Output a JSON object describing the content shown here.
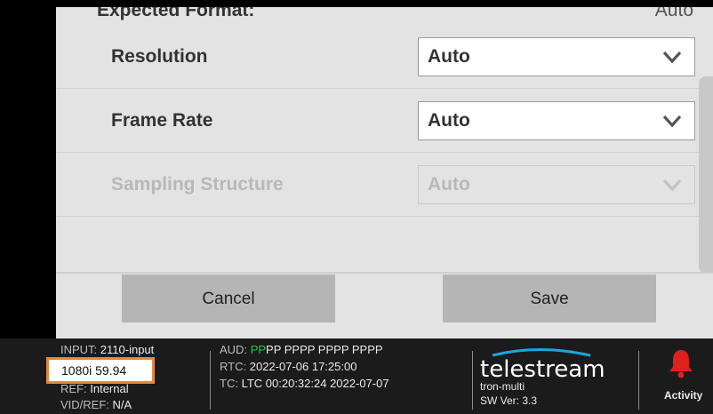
{
  "settings": {
    "expected_format": {
      "label": "Expected Format:",
      "value": "Auto"
    },
    "fields": [
      {
        "label": "Resolution",
        "value": "Auto",
        "enabled": true
      },
      {
        "label": "Frame Rate",
        "value": "Auto",
        "enabled": true
      },
      {
        "label": "Sampling Structure",
        "value": "Auto",
        "enabled": false
      }
    ]
  },
  "actions": {
    "cancel": "Cancel",
    "save": "Save"
  },
  "status": {
    "input_key": "INPUT:",
    "input_val": "2110-input",
    "format": "1080i 59.94",
    "ref_key": "REF:",
    "ref_val": "Internal",
    "vidref_key": "VID/REF:",
    "vidref_val": "N/A",
    "aud_key": "AUD:",
    "aud_green": "PP",
    "aud_rest": "PP PPPP PPPP PPPP",
    "rtc_key": "RTC:",
    "rtc_val": "2022-07-06 17:25:00",
    "tc_key": "TC:",
    "tc_val": "LTC 00:20:32:24 2022-07-07",
    "brand": "telestream",
    "device": "tron-multi",
    "sw_version": "SW Ver: 3.3",
    "activity": "Activity"
  },
  "colors": {
    "highlight_border": "#e4883a",
    "aud_ok": "#29c54a",
    "alarm": "#e01f1f",
    "logo_swoosh": "#19a7e0"
  }
}
